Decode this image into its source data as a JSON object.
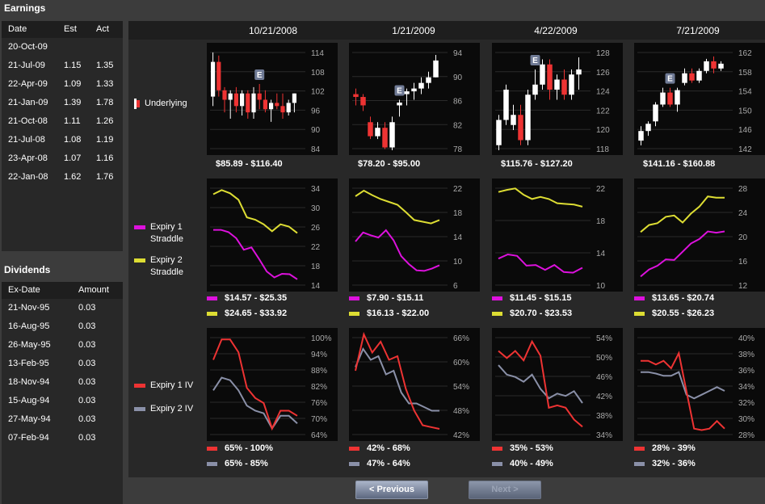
{
  "earnings": {
    "title": "Earnings",
    "columns": [
      "Date",
      "Est",
      "Act"
    ],
    "rows": [
      [
        "20-Oct-09",
        "",
        ""
      ],
      [
        "21-Jul-09",
        "1.15",
        "1.35"
      ],
      [
        "22-Apr-09",
        "1.09",
        "1.33"
      ],
      [
        "21-Jan-09",
        "1.39",
        "1.78"
      ],
      [
        "21-Oct-08",
        "1.11",
        "1.26"
      ],
      [
        "21-Jul-08",
        "1.08",
        "1.19"
      ],
      [
        "23-Apr-08",
        "1.07",
        "1.16"
      ],
      [
        "22-Jan-08",
        "1.62",
        "1.76"
      ]
    ]
  },
  "dividends": {
    "title": "Dividends",
    "columns": [
      "Ex-Date",
      "Amount"
    ],
    "rows": [
      [
        "21-Nov-95",
        "0.03"
      ],
      [
        "16-Aug-95",
        "0.03"
      ],
      [
        "26-May-95",
        "0.03"
      ],
      [
        "13-Feb-95",
        "0.03"
      ],
      [
        "18-Nov-94",
        "0.03"
      ],
      [
        "15-Aug-94",
        "0.03"
      ],
      [
        "27-May-94",
        "0.03"
      ],
      [
        "07-Feb-94",
        "0.03"
      ]
    ]
  },
  "column_dates": [
    "10/21/2008",
    "1/21/2009",
    "4/22/2009",
    "7/21/2009"
  ],
  "row_labels": {
    "underlying": "Underlying",
    "expiry1_straddle": [
      "Expiry 1",
      "Straddle"
    ],
    "expiry2_straddle": [
      "Expiry 2",
      "Straddle"
    ],
    "expiry1_iv": "Expiry 1 IV",
    "expiry2_iv": "Expiry 2 IV"
  },
  "earnings_marker": "E",
  "colors": {
    "up": "#ffffff",
    "down": "#ee3333",
    "expiry1_straddle": "#dd11dd",
    "expiry2_straddle": "#dddd33",
    "expiry1_iv": "#ee3333",
    "expiry2_iv": "#8a90a8",
    "background": "#3c3c3c"
  },
  "buttons": {
    "previous": "< Previous",
    "next": "Next >"
  },
  "chart_data": [
    {
      "type": "candlestick",
      "name": "Underlying",
      "date": "10/21/2008",
      "ylim": [
        84,
        116
      ],
      "yticks": [
        "114",
        "108",
        "102",
        "96",
        "90",
        "84"
      ],
      "range_text": "$85.89  -  $116.40",
      "earnings_marker_index": 8,
      "candles": [
        [
          101,
          115,
          98,
          112
        ],
        [
          112,
          114,
          101,
          103
        ],
        [
          103,
          104,
          96,
          100
        ],
        [
          100,
          103,
          94,
          102
        ],
        [
          102,
          104,
          96,
          98
        ],
        [
          98,
          103,
          95,
          102
        ],
        [
          102,
          103,
          94,
          96
        ],
        [
          96,
          104,
          94,
          102
        ],
        [
          102,
          105,
          97,
          100
        ],
        [
          100,
          103,
          96,
          97
        ],
        [
          97,
          100,
          93,
          99
        ],
        [
          99,
          102,
          97,
          98
        ],
        [
          98,
          102,
          94,
          96
        ],
        [
          96,
          100,
          95,
          99
        ],
        [
          99,
          102,
          96,
          102
        ]
      ]
    },
    {
      "type": "candlestick",
      "name": "Underlying",
      "date": "1/21/2009",
      "ylim": [
        78,
        96
      ],
      "yticks": [
        "94",
        "90",
        "86",
        "82",
        "78"
      ],
      "range_text": "$78.20  -  $95.00",
      "earnings_marker_index": 6,
      "candles": [
        [
          88,
          89,
          86,
          87.5
        ],
        [
          87.5,
          88,
          85,
          86
        ],
        [
          83,
          84,
          80,
          80.5
        ],
        [
          80.5,
          83,
          80,
          82
        ],
        [
          82,
          83,
          78.2,
          78.5
        ],
        [
          78.5,
          84,
          78,
          83
        ],
        [
          86,
          87,
          84,
          86.5
        ],
        [
          88,
          89,
          86,
          88.5
        ],
        [
          88.5,
          90,
          87,
          89
        ],
        [
          89,
          91,
          88,
          90
        ],
        [
          90,
          92,
          89,
          91
        ],
        [
          91,
          95,
          91,
          94
        ]
      ]
    },
    {
      "type": "candlestick",
      "name": "Underlying",
      "date": "4/22/2009",
      "ylim": [
        118,
        128
      ],
      "yticks": [
        "128",
        "126",
        "124",
        "122",
        "120",
        "118"
      ],
      "range_text": "$115.76  -  $127.20",
      "earnings_marker_index": 5,
      "candles": [
        [
          118.5,
          121.5,
          118,
          121
        ],
        [
          121,
          124.5,
          120.5,
          124
        ],
        [
          120.5,
          122.5,
          120,
          121.5
        ],
        [
          121.5,
          122.5,
          118.5,
          119
        ],
        [
          119,
          124,
          118.5,
          123.5
        ],
        [
          123.5,
          126,
          123,
          124.5
        ],
        [
          124.5,
          127,
          124,
          126.5
        ],
        [
          126.5,
          127,
          123,
          124
        ],
        [
          124,
          125.5,
          123,
          125
        ],
        [
          125,
          126,
          123,
          123.5
        ],
        [
          123.5,
          126,
          123,
          125.5
        ],
        [
          125.5,
          127.2,
          124,
          126
        ]
      ]
    },
    {
      "type": "candlestick",
      "name": "Underlying",
      "date": "7/21/2009",
      "ylim": [
        142,
        163
      ],
      "yticks": [
        "162",
        "158",
        "154",
        "150",
        "146",
        "142"
      ],
      "range_text": "$141.16  -  $160.88",
      "earnings_marker_index": 4,
      "candles": [
        [
          144,
          147,
          143,
          146
        ],
        [
          146,
          148,
          145,
          147.5
        ],
        [
          148,
          152,
          147,
          151.5
        ],
        [
          151.5,
          155,
          151,
          154
        ],
        [
          154,
          155,
          151,
          151.5
        ],
        [
          151.5,
          155,
          150,
          154.5
        ],
        [
          156,
          159,
          155.5,
          158
        ],
        [
          158,
          159,
          156,
          156.5
        ],
        [
          156.5,
          159,
          156,
          158.5
        ],
        [
          158.5,
          161,
          158,
          160.5
        ],
        [
          160.5,
          161.5,
          158,
          159
        ],
        [
          159,
          160.5,
          158.5,
          160
        ]
      ]
    },
    {
      "type": "line",
      "name": "Straddle",
      "date": "10/21/2008",
      "ylim": [
        13,
        35
      ],
      "yticks": [
        "34",
        "30",
        "26",
        "22",
        "18",
        "14"
      ],
      "series": [
        {
          "name": "Expiry 1 Straddle",
          "values": [
            25.3,
            25.3,
            24.8,
            23.5,
            21,
            21.5,
            19,
            16.3,
            15,
            15.8,
            15.7,
            14.6
          ],
          "range_text": "$14.57  -  $25.35"
        },
        {
          "name": "Expiry 2 Straddle",
          "values": [
            33,
            33.9,
            33.2,
            31.8,
            28,
            27.5,
            26.5,
            25,
            26.5,
            26,
            24.6
          ],
          "range_text": "$24.65  -  $33.92"
        }
      ]
    },
    {
      "type": "line",
      "name": "Straddle",
      "date": "1/21/2009",
      "ylim": [
        5,
        23
      ],
      "yticks": [
        "22",
        "18",
        "14",
        "10",
        "6"
      ],
      "series": [
        {
          "name": "Expiry 1 Straddle",
          "values": [
            13,
            14.6,
            14.1,
            13.7,
            15,
            13.2,
            10.4,
            9,
            7.9,
            7.8,
            8.2,
            8.8
          ],
          "range_text": "$7.90  -  $15.11"
        },
        {
          "name": "Expiry 2 Straddle",
          "values": [
            21,
            22,
            21.2,
            20.5,
            20,
            19.5,
            18.2,
            16.8,
            16.5,
            16.2,
            16.8
          ],
          "range_text": "$16.13  -  $22.00"
        }
      ]
    },
    {
      "type": "line",
      "name": "Straddle",
      "date": "4/22/2009",
      "ylim": [
        9.5,
        24
      ],
      "yticks": [
        "22",
        "18",
        "14",
        "10"
      ],
      "series": [
        {
          "name": "Expiry 1 Straddle",
          "values": [
            13.5,
            14.1,
            13.9,
            12.5,
            12.6,
            11.9,
            12.6,
            11.6,
            11.5,
            12.2
          ],
          "range_text": "$11.45  -  $15.15"
        },
        {
          "name": "Expiry 2 Straddle",
          "values": [
            23,
            23.3,
            23.5,
            22.6,
            22,
            22.3,
            22,
            21.4,
            21.3,
            21.2,
            20.9
          ],
          "range_text": "$20.70  -  $23.53"
        }
      ]
    },
    {
      "type": "line",
      "name": "Straddle",
      "date": "7/21/2009",
      "ylim": [
        12,
        28
      ],
      "yticks": [
        "28",
        "24",
        "20",
        "16",
        "12"
      ],
      "series": [
        {
          "name": "Expiry 1 Straddle",
          "values": [
            13.6,
            14.7,
            15.3,
            16.3,
            16.2,
            17.5,
            18.8,
            19.5,
            20.7,
            20.5,
            20.7
          ],
          "range_text": "$13.65  -  $20.74"
        },
        {
          "name": "Expiry 2 Straddle",
          "values": [
            20.6,
            21.7,
            22,
            23,
            23.2,
            22.1,
            23.5,
            24.6,
            26.2,
            26,
            26
          ],
          "range_text": "$20.55  -  $26.23"
        }
      ]
    },
    {
      "type": "line",
      "name": "IV",
      "date": "10/21/2008",
      "ylim": [
        62,
        102
      ],
      "yticks": [
        "100%",
        "94%",
        "88%",
        "82%",
        "76%",
        "70%",
        "64%"
      ],
      "series": [
        {
          "name": "Expiry 1 IV",
          "values": [
            92,
            100,
            100,
            95,
            81,
            77,
            75,
            65,
            72,
            72,
            70
          ],
          "range_text": "65%  -  100%"
        },
        {
          "name": "Expiry 2 IV",
          "values": [
            80,
            85,
            84,
            80,
            74,
            72,
            71,
            65,
            70,
            70,
            67
          ],
          "range_text": "65%  -  85%"
        }
      ]
    },
    {
      "type": "line",
      "name": "IV",
      "date": "1/21/2009",
      "ylim": [
        40,
        68
      ],
      "yticks": [
        "66%",
        "60%",
        "54%",
        "48%",
        "42%"
      ],
      "series": [
        {
          "name": "Expiry 1 IV",
          "values": [
            58,
            68,
            63,
            66,
            61,
            62,
            53,
            47,
            43,
            42.5,
            42
          ],
          "range_text": "42%  -  68%"
        },
        {
          "name": "Expiry 2 IV",
          "values": [
            59,
            64,
            61,
            62,
            57,
            58,
            52,
            49,
            49,
            48,
            47,
            47
          ],
          "range_text": "47%  -  64%"
        }
      ]
    },
    {
      "type": "line",
      "name": "IV",
      "date": "4/22/2009",
      "ylim": [
        33,
        54.5
      ],
      "yticks": [
        "54%",
        "50%",
        "46%",
        "42%",
        "38%",
        "34%"
      ],
      "series": [
        {
          "name": "Expiry 1 IV",
          "values": [
            51,
            49.5,
            51,
            49,
            53,
            50,
            39,
            39.5,
            39,
            36.5,
            35
          ],
          "range_text": "35%  -  53%"
        },
        {
          "name": "Expiry 2 IV",
          "values": [
            48,
            46,
            45.5,
            44.5,
            46,
            43,
            41,
            42,
            41.5,
            42.5,
            40
          ],
          "range_text": "40%  -  49%"
        }
      ]
    },
    {
      "type": "line",
      "name": "IV",
      "date": "7/21/2009",
      "ylim": [
        27,
        40.5
      ],
      "yticks": [
        "40%",
        "38%",
        "36%",
        "34%",
        "32%",
        "30%",
        "28%"
      ],
      "series": [
        {
          "name": "Expiry 1 IV",
          "values": [
            37,
            37,
            36.5,
            37,
            36,
            38,
            33,
            28,
            27.8,
            28,
            29,
            28
          ],
          "range_text": "28%  -  39%"
        },
        {
          "name": "Expiry 2 IV",
          "values": [
            35.5,
            35.5,
            35.3,
            35,
            35,
            35.5,
            32.5,
            32,
            32.5,
            33,
            33.5,
            33
          ],
          "range_text": "32%  -  36%"
        }
      ]
    }
  ]
}
